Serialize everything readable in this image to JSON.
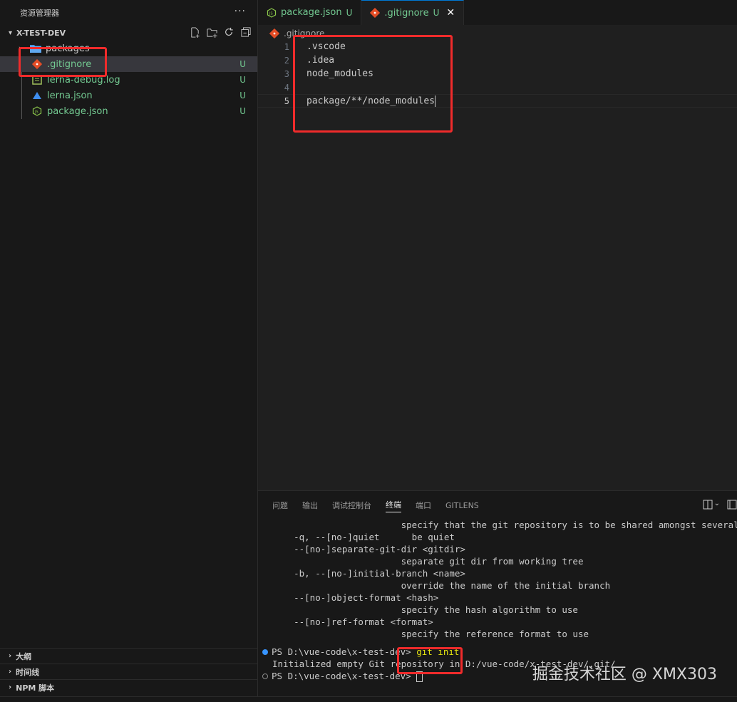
{
  "sidebar": {
    "title": "资源管理器",
    "more": "···",
    "project": "X-TEST-DEV",
    "items": [
      {
        "name": "packages",
        "type": "folder"
      },
      {
        "name": ".gitignore",
        "badge": "U"
      },
      {
        "name": "lerna-debug.log",
        "badge": "U"
      },
      {
        "name": "lerna.json",
        "badge": "U"
      },
      {
        "name": "package.json",
        "badge": "U"
      }
    ],
    "bottom_sections": [
      "大纲",
      "时间线",
      "NPM 脚本"
    ]
  },
  "tabs": [
    {
      "label": "package.json",
      "badge": "U"
    },
    {
      "label": ".gitignore",
      "badge": "U",
      "close": "✕"
    }
  ],
  "breadcrumb": ".gitignore",
  "editor": {
    "lines": [
      {
        "num": "1",
        "text": ".vscode"
      },
      {
        "num": "2",
        "text": ".idea"
      },
      {
        "num": "3",
        "text": "node_modules"
      },
      {
        "num": "4",
        "text": ""
      },
      {
        "num": "5",
        "text": "package/**/node_modules"
      }
    ]
  },
  "panel": {
    "tabs": [
      "问题",
      "输出",
      "调试控制台",
      "终端",
      "端口",
      "GITLENS"
    ],
    "terminal_lines": [
      "                        specify that the git repository is to be shared amongst several users",
      "    -q, --[no-]quiet      be quiet",
      "    --[no-]separate-git-dir <gitdir>",
      "                        separate git dir from working tree",
      "    -b, --[no-]initial-branch <name>",
      "                        override the name of the initial branch",
      "    --[no-]object-format <hash>",
      "                        specify the hash algorithm to use",
      "    --[no-]ref-format <format>",
      "                        specify the reference format to use"
    ],
    "prompt1": "PS D:\\vue-code\\x-test-dev> ",
    "command": "git init",
    "output": "Initialized empty Git repository in D:/vue-code/x-test-dev/.git/",
    "prompt2": "PS D:\\vue-code\\x-test-dev> "
  },
  "watermark": "掘金技术社区 @ XMX303",
  "colors": {
    "untracked": "#73c991",
    "highlight": "#f02b2b",
    "accent": "#0078d4"
  }
}
